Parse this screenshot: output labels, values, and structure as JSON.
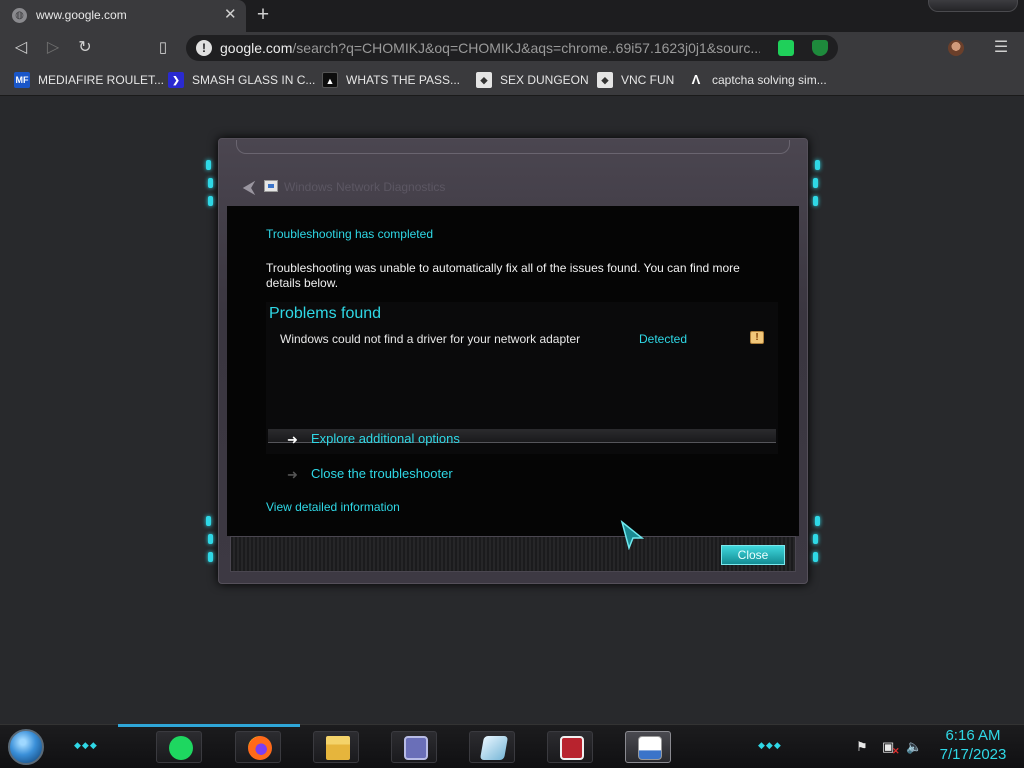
{
  "browser": {
    "tab": {
      "title": "www.google.com"
    },
    "omnibox": {
      "domain": "google.com",
      "path": "/search?q=CHOMIKJ&oq=CHOMIKJ&aqs=chrome..69i57.1623j0j1&sourc..."
    },
    "bookmarks": [
      {
        "label": "MEDIAFIRE ROULET...",
        "icon": "mediafire-icon",
        "icon_text": "MF"
      },
      {
        "label": "SMASH GLASS IN C...",
        "icon": "chevron-icon",
        "icon_text": "❯"
      },
      {
        "label": "WHATS THE PASS...",
        "icon": "terminal-icon",
        "icon_text": "▲"
      },
      {
        "label": "SEX DUNGEON",
        "icon": "vnc-icon",
        "icon_text": "◆"
      },
      {
        "label": "VNC FUN",
        "icon": "vnc-icon",
        "icon_text": "◆"
      },
      {
        "label": "captcha solving sim...",
        "icon": "caret-logo-icon",
        "icon_text": "Λ"
      }
    ]
  },
  "dialog": {
    "window_title": "Windows Network Diagnostics",
    "status_heading": "Troubleshooting has completed",
    "summary": "Troubleshooting was unable to automatically fix all of the issues found. You can find more details below.",
    "problems_title": "Problems found",
    "problem": {
      "text": "Windows could not find a driver for your network adapter",
      "status": "Detected",
      "warn_glyph": "!"
    },
    "explore_label": "Explore additional options",
    "close_troubleshooter_label": "Close the troubleshooter",
    "view_details_label": "View detailed information",
    "close_button_label": "Close"
  },
  "taskbar": {
    "apps": [
      "spotify-icon",
      "firefox-icon",
      "file-explorer-icon",
      "id-card-icon",
      "glass-shard-icon",
      "news-reader-icon",
      "network-diagnostics-icon"
    ],
    "clock": {
      "time": "6:16 AM",
      "date": "7/17/2023"
    }
  },
  "colors": {
    "accent": "#2fd8e6",
    "background": "#28292c",
    "content_bg": "#050505"
  }
}
